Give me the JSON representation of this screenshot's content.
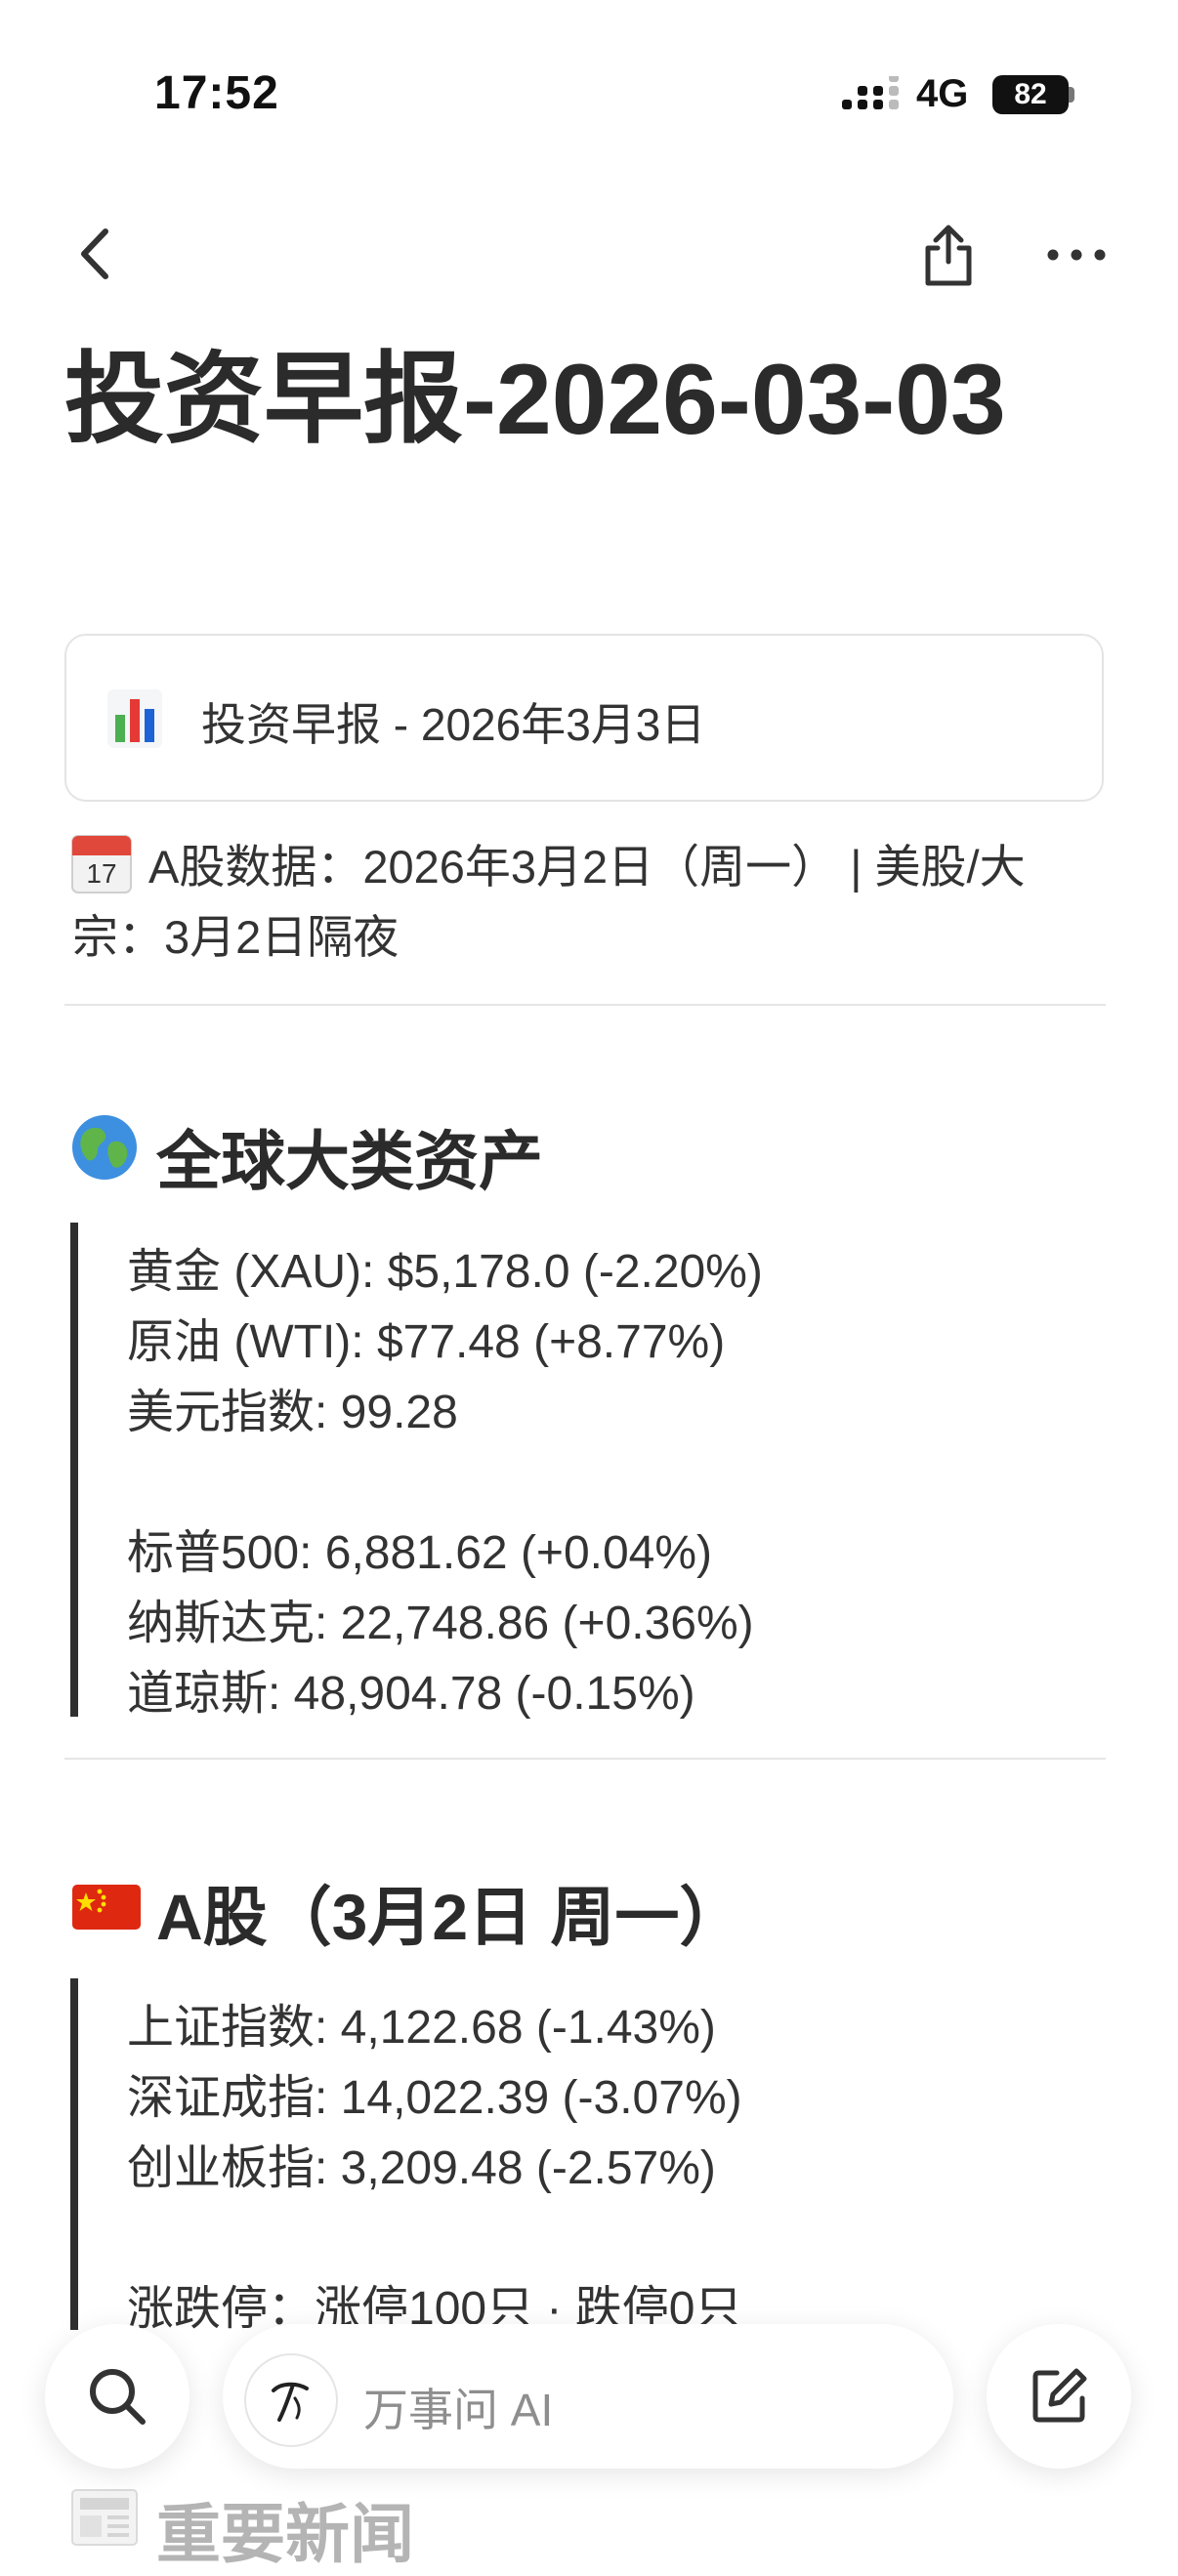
{
  "status_bar": {
    "time": "17:52",
    "network": "4G",
    "battery": "82"
  },
  "nav": {
    "back_icon": "chevron-left-icon",
    "share_icon": "share-icon",
    "more_icon": "more-icon"
  },
  "page": {
    "title": "投资早报-2026-03-03"
  },
  "callout": {
    "icon": "bar-chart-icon",
    "text": "投资早报 - 2026年3月3日"
  },
  "meta": {
    "icon": "calendar-icon",
    "text": "A股数据：2026年3月2日（周一） | 美股/大宗：3月2日隔夜"
  },
  "sections": {
    "global": {
      "icon": "globe-icon",
      "heading": "全球大类资产",
      "lines": [
        "黄金 (XAU): $5,178.0 (-2.20%)",
        "原油 (WTI): $77.48 (+8.77%)",
        "美元指数: 99.28",
        "标普500: 6,881.62 (+0.04%)",
        "纳斯达克: 22,748.86 (+0.36%)",
        "道琼斯: 48,904.78 (-0.15%)"
      ]
    },
    "a_share": {
      "icon": "china-flag-icon",
      "heading": "A股（3月2日 周一）",
      "lines": [
        "上证指数: 4,122.68 (-1.43%)",
        "深证成指: 14,022.39 (-3.07%)",
        "创业板指: 3,209.48 (-2.57%)",
        "涨跌停：涨停100只 · 跌停0只"
      ]
    },
    "news": {
      "icon": "newspaper-icon",
      "heading": "重要新闻"
    }
  },
  "bottom_bar": {
    "search_icon": "search-icon",
    "ai_logo": "ai-logo-icon",
    "ai_placeholder": "万事问 AI",
    "compose_icon": "compose-icon"
  }
}
